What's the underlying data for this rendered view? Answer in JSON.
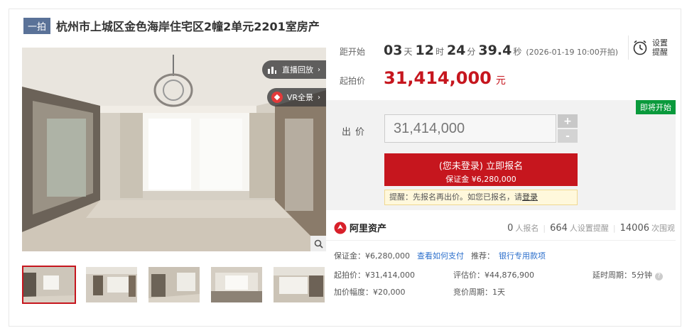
{
  "header": {
    "tag": "一拍",
    "title": "杭州市上城区金色海岸住宅区2幢2单元2201室房产"
  },
  "media": {
    "live_replay_label": "直播回放",
    "vr_label": "VR全景",
    "live_icon": "bar-chart-icon",
    "vr_icon": "vr-diamond-icon",
    "zoom_icon": "magnifier-icon",
    "thumbnail_count": 5,
    "active_thumbnail": 1
  },
  "countdown": {
    "label": "距开始",
    "days": "03",
    "days_unit": "天",
    "hours": "12",
    "hours_unit": "时",
    "minutes": "24",
    "minutes_unit": "分",
    "seconds": "39.4",
    "seconds_unit": "秒",
    "start_time": "(2026-01-19 10:00开拍)"
  },
  "reminder": {
    "label": "设置提醒",
    "icon": "alarm-clock-icon"
  },
  "start_price": {
    "label": "起拍价",
    "value": "31,414,000",
    "unit": "元"
  },
  "bid": {
    "status_badge": "即将开始",
    "label": "出价",
    "input_value": "31,414,000",
    "plus": "+",
    "minus": "-",
    "register_main": "(您未登录) 立即报名",
    "register_sub": "保证金 ¥6,280,000",
    "notice_prefix": "提醒：先报名再出价。如您已报名，请",
    "notice_login": "登录"
  },
  "platform": {
    "name": "阿里资产",
    "registered_count": "0",
    "registered_label": "人报名",
    "reminders_count": "664",
    "reminders_label": "人设置提醒",
    "views_count": "14006",
    "views_label": "次围观"
  },
  "details": {
    "deposit": "保证金：¥6,280,000",
    "how_to_pay": "查看如何支付",
    "recommend_label": "推荐：",
    "bank_loan": "银行专用款项",
    "start_price": "起拍价：¥31,414,000",
    "assessed_price": "评估价：¥44,876,900",
    "extension": "延时周期：5分钟",
    "increment": "加价幅度：¥20,000",
    "bid_cycle": "竞价周期：1天"
  },
  "colors": {
    "accent_red": "#c6161e",
    "badge_green": "#0a9a3c",
    "link_blue": "#2c6fcc",
    "tag_blue": "#5a7298"
  }
}
